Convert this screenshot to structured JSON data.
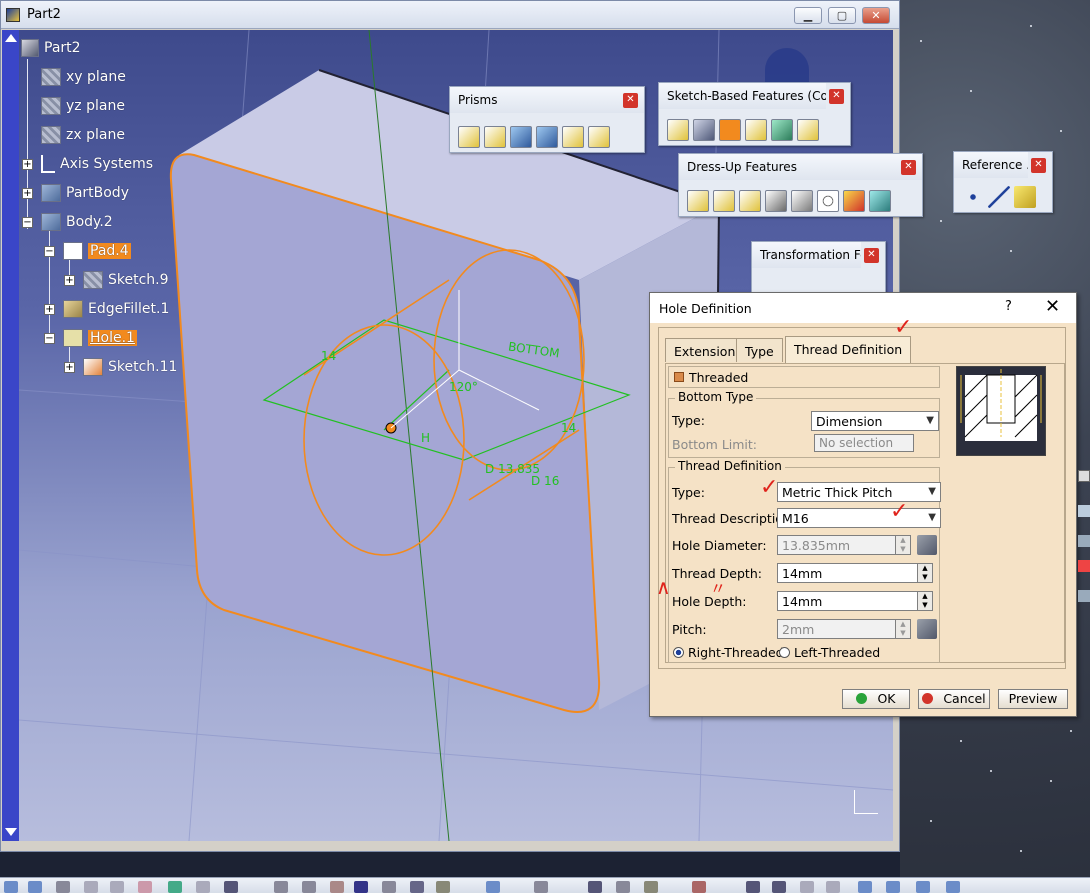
{
  "window": {
    "title": "Part2"
  },
  "tree": {
    "root": "Part2",
    "items": [
      {
        "label": "xy plane"
      },
      {
        "label": "yz plane"
      },
      {
        "label": "zx plane"
      },
      {
        "label": "Axis Systems"
      },
      {
        "label": "PartBody"
      },
      {
        "label": "Body.2"
      },
      {
        "label": "Pad.4"
      },
      {
        "label": "Sketch.9"
      },
      {
        "label": "EdgeFillet.1"
      },
      {
        "label": "Hole.1"
      },
      {
        "label": "Sketch.11"
      }
    ]
  },
  "toolbars": {
    "prisms": "Prisms",
    "sketch_based": "Sketch-Based Features (Com...",
    "dressup": "Dress-Up Features",
    "reference": "Reference ...",
    "transformation": "Transformation Fe..."
  },
  "sketch_annotations": {
    "bottom": "BOTTOM",
    "angle": "120°",
    "diameter": "D 13.835",
    "d16": "D  16",
    "dim14a": "14",
    "dim14b": "14",
    "h": "H"
  },
  "dialog": {
    "title": "Hole Definition",
    "help": "?",
    "tabs": [
      "Extension",
      "Type",
      "Thread Definition"
    ],
    "threaded_label": "Threaded",
    "bottom_type": {
      "group": "Bottom Type",
      "type_label": "Type:",
      "type_value": "Dimension",
      "limit_label": "Bottom Limit:",
      "limit_value": "No selection"
    },
    "thread_def": {
      "group": "Thread Definition",
      "type_label": "Type:",
      "type_value": "Metric Thick Pitch",
      "desc_label": "Thread Description:",
      "desc_value": "M16",
      "hole_dia_label": "Hole Diameter:",
      "hole_dia_value": "13.835mm",
      "thread_depth_label": "Thread Depth:",
      "thread_depth_value": "14mm",
      "hole_depth_label": "Hole Depth:",
      "hole_depth_value": "14mm",
      "pitch_label": "Pitch:",
      "pitch_value": "2mm",
      "right_label": "Right-Threaded",
      "left_label": "Left-Threaded"
    },
    "buttons": {
      "ok": "OK",
      "cancel": "Cancel",
      "preview": "Preview"
    }
  },
  "colors": {
    "accent": "#f28a1e",
    "mark": "#e0241c",
    "sketch": "#22c022"
  }
}
